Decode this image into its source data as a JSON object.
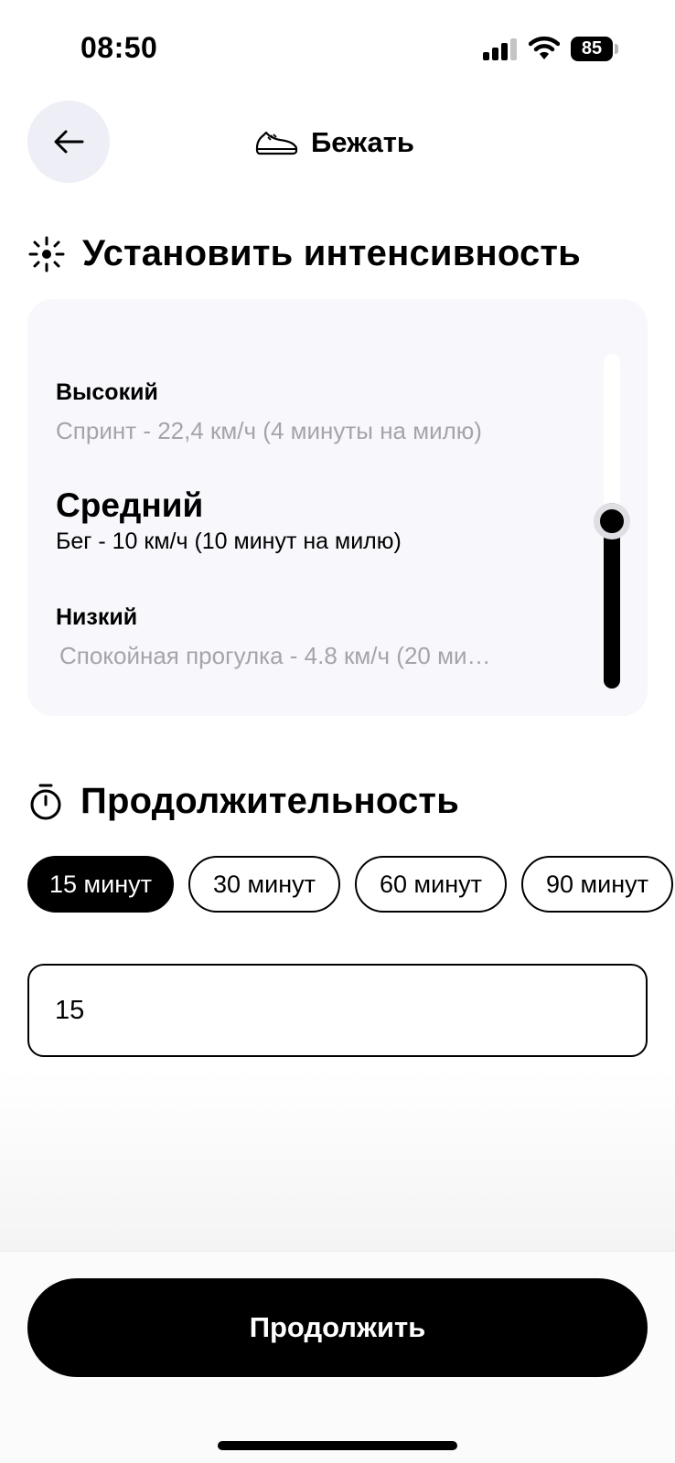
{
  "status_bar": {
    "time": "08:50",
    "battery": "85"
  },
  "header": {
    "title": "Бежать",
    "icon": "sneaker-icon",
    "back_icon": "arrow-left-icon"
  },
  "intensity": {
    "title": "Установить интенсивность",
    "icon": "intensity-icon",
    "levels": [
      {
        "name": "Высокий",
        "description": "Спринт - 22,4 км/ч (4 минуты на милю)"
      },
      {
        "name": "Средний",
        "description": "Бег - 10 км/ч (10 минут на милю)"
      },
      {
        "name": "Низкий",
        "description": "Спокойная прогулка - 4.8 км/ч (20 ми…"
      }
    ],
    "selected_index": 1,
    "slider_level": 0.5
  },
  "duration": {
    "title": "Продолжительность",
    "icon": "stopwatch-icon",
    "options": [
      "15 минут",
      "30 минут",
      "60 минут",
      "90 минут"
    ],
    "selected_index": 0,
    "input_value": "15"
  },
  "footer": {
    "continue_label": "Продолжить"
  }
}
